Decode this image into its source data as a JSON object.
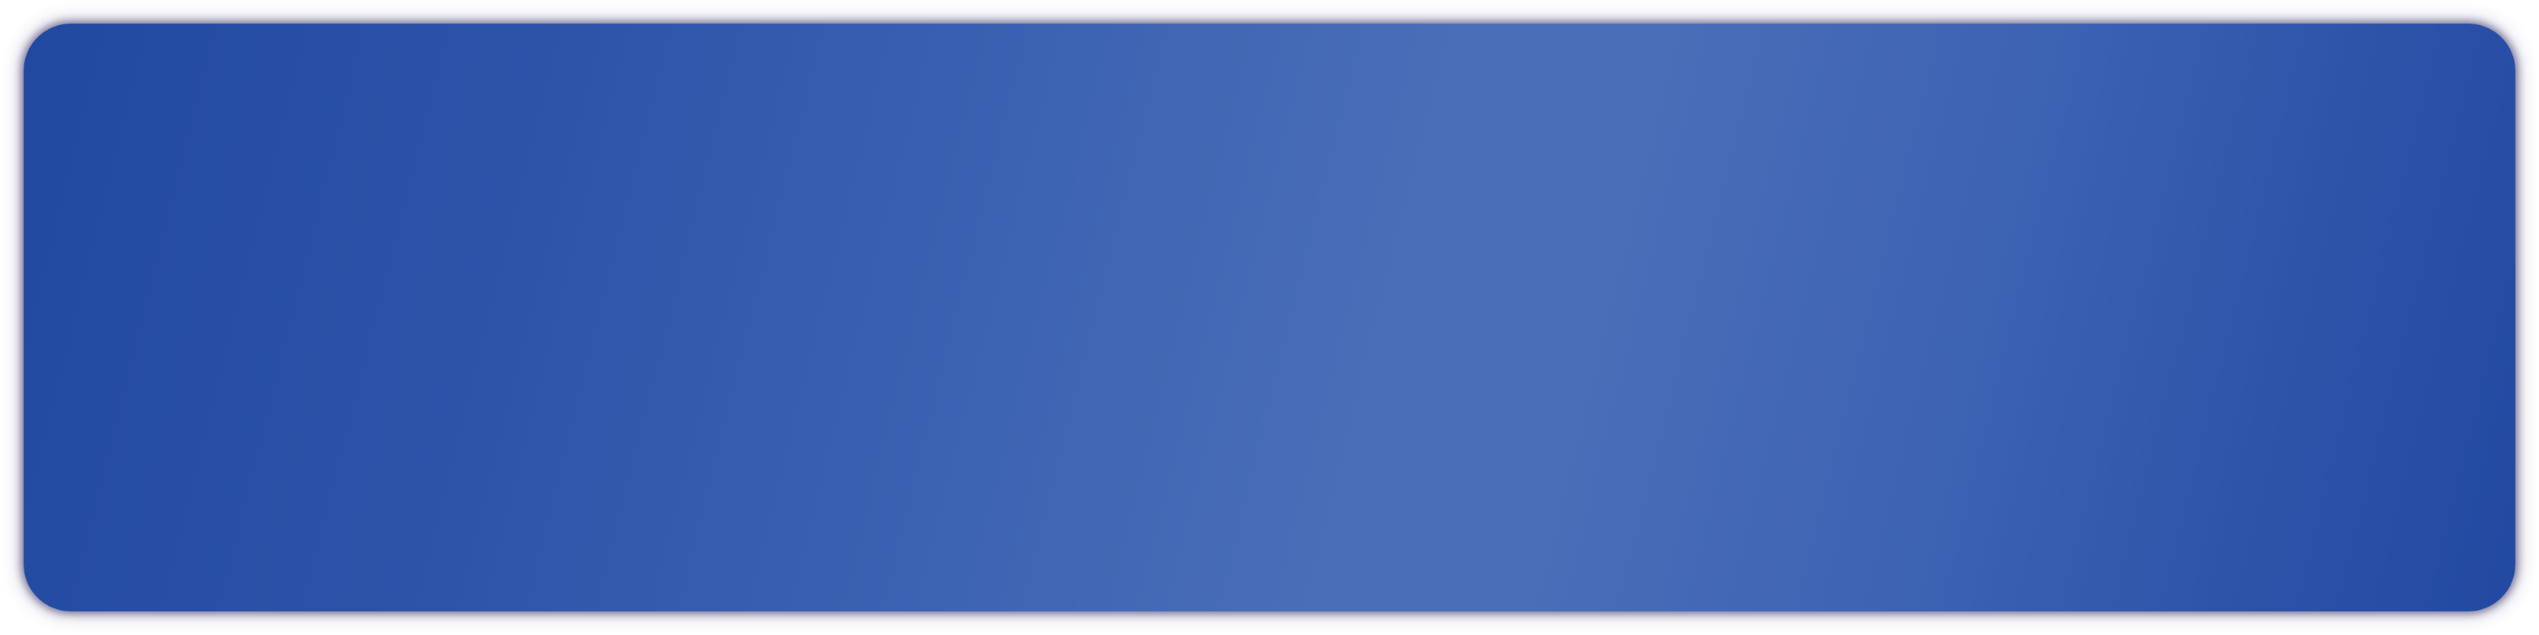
{
  "panel": {
    "accent_colors": {
      "gradient_dark": "#2149a0",
      "gradient_light": "#4b6eb8",
      "shadow": "#2e245a"
    }
  }
}
